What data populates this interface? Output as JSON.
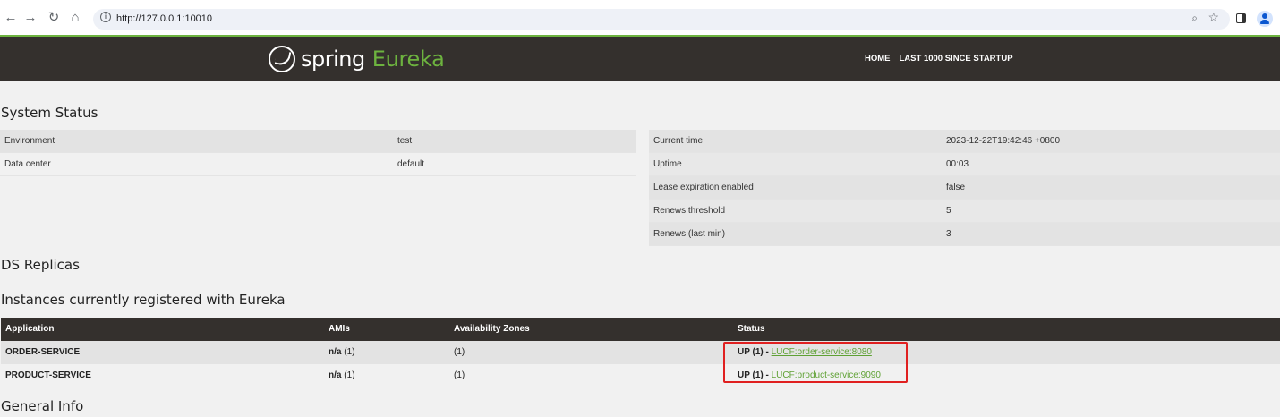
{
  "browser": {
    "url": "http://127.0.0.1:10010",
    "back_icon": "back-arrow-icon",
    "forward_icon": "forward-arrow-icon",
    "reload_icon": "reload-icon",
    "home_icon": "home-icon"
  },
  "header": {
    "logo_spring": "spring",
    "logo_eureka": "Eureka",
    "nav": [
      "HOME",
      "LAST 1000 SINCE STARTUP"
    ],
    "bg_color": "#34302d",
    "accent_color": "#6db33f"
  },
  "system_status": {
    "title": "System Status",
    "left": [
      {
        "key": "Environment",
        "value": "test"
      },
      {
        "key": "Data center",
        "value": "default"
      }
    ],
    "right": [
      {
        "key": "Current time",
        "value": "2023-12-22T19:42:46 +0800"
      },
      {
        "key": "Uptime",
        "value": "00:03"
      },
      {
        "key": "Lease expiration enabled",
        "value": "false"
      },
      {
        "key": "Renews threshold",
        "value": "5"
      },
      {
        "key": "Renews (last min)",
        "value": "3"
      }
    ]
  },
  "ds_replicas": {
    "title": "DS Replicas"
  },
  "instances": {
    "title": "Instances currently registered with Eureka",
    "columns": [
      "Application",
      "AMIs",
      "Availability Zones",
      "Status"
    ],
    "rows": [
      {
        "application": "ORDER-SERVICE",
        "ami_label": "n/a",
        "ami_count": "(1)",
        "zones": "(1)",
        "status": "UP (1) - ",
        "link": "LUCF:order-service:8080"
      },
      {
        "application": "PRODUCT-SERVICE",
        "ami_label": "n/a",
        "ami_count": "(1)",
        "zones": "(1)",
        "status": "UP (1) - ",
        "link": "LUCF:product-service:9090"
      }
    ]
  },
  "general_info": {
    "title": "General Info"
  }
}
